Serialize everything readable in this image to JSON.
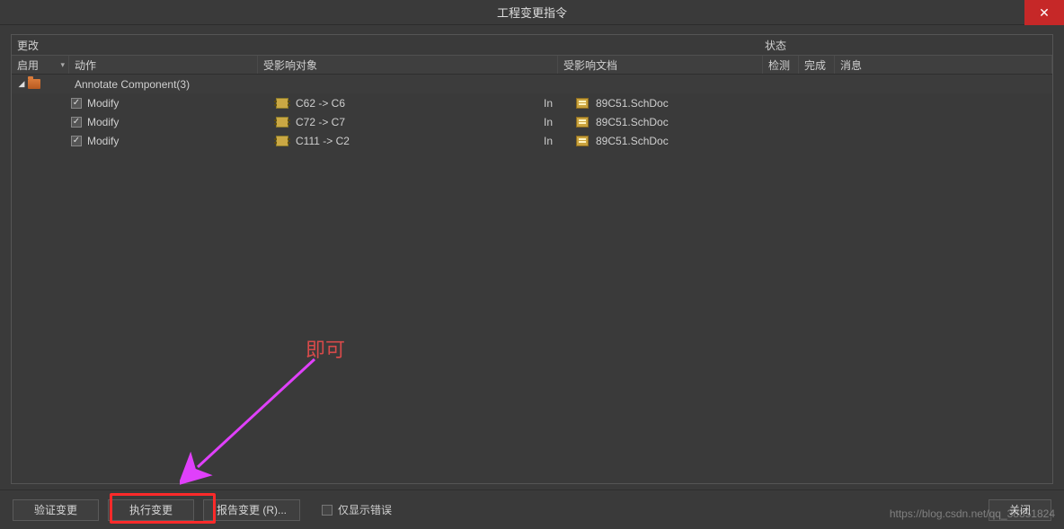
{
  "window": {
    "title": "工程变更指令",
    "close_glyph": "✕"
  },
  "sections": {
    "changes": "更改",
    "status": "状态"
  },
  "columns": {
    "enable": "启用",
    "action": "动作",
    "object": "受影响对象",
    "document": "受影响文档",
    "check": "检测",
    "done": "完成",
    "message": "消息"
  },
  "group": {
    "label": "Annotate Component(3)"
  },
  "rows": [
    {
      "checked": true,
      "action": "Modify",
      "object": "C62 -> C6",
      "relation": "In",
      "document": "89C51.SchDoc"
    },
    {
      "checked": true,
      "action": "Modify",
      "object": "C72 -> C7",
      "relation": "In",
      "document": "89C51.SchDoc"
    },
    {
      "checked": true,
      "action": "Modify",
      "object": "C111 -> C2",
      "relation": "In",
      "document": "89C51.SchDoc"
    }
  ],
  "buttons": {
    "validate": "验证变更",
    "execute": "执行变更",
    "report": "报告变更 (R)...",
    "errors_only": "仅显示错误",
    "close": "关闭"
  },
  "annotation": {
    "text": "即可"
  },
  "watermark": "https://blog.csdn.net/qq_38351824"
}
